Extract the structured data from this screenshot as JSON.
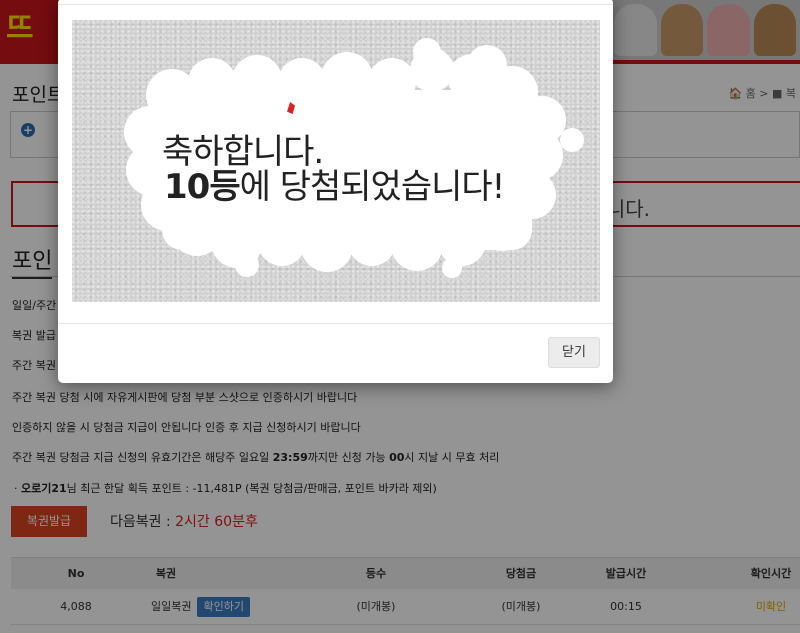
{
  "header": {
    "logo_text": "뜨기",
    "brand_color": "#c8161d"
  },
  "page": {
    "title": "포인트",
    "breadcrumb": "🏠 홈 > ■ 복"
  },
  "notice": {
    "text": "니다."
  },
  "section": {
    "title": "포인"
  },
  "info_lines": [
    "일일/주간",
    "복권 발급",
    "주간 복권",
    "주간 복권 당첨 시에 자유게시판에 당첨 부분 스샷으로 인증하시기 바랍니다",
    "인증하지 않을 시 당첨금 지급이 안됩니다 인증 후 지급 신청하시기 바랍니다"
  ],
  "info_expiry": {
    "prefix": "주간 복권 당첨금 지급 신청의 유효기간은 해당주 일요일 ",
    "time1": "23:59",
    "middle": "까지만 신청 가능 ",
    "time2": "00",
    "suffix": "시 지날 시 무효 처리"
  },
  "points": {
    "bullet": "·",
    "user": "오로기21",
    "text": "님 최근 한달 획득 포인트 : -11,481P (복권 당첨금/판매금, 포인트 바카라 제외)"
  },
  "actions": {
    "issue_label": "복권발급",
    "next_label": "다음복권 : ",
    "next_value": "2시간 60분후"
  },
  "table": {
    "headers": [
      "No",
      "복권",
      "등수",
      "당첨금",
      "발급시간",
      "확인시간"
    ],
    "rows": [
      {
        "no": "4,088",
        "lottery": "일일복권",
        "confirm_label": "확인하기",
        "rank": "(미개봉)",
        "prize": "(미개봉)",
        "issued": "00:15",
        "checked": "미확인"
      }
    ]
  },
  "modal": {
    "line1": "축하합니다.",
    "rank": "10등",
    "line2_rest": "에 당첨되었습니다!",
    "close_label": "닫기"
  }
}
